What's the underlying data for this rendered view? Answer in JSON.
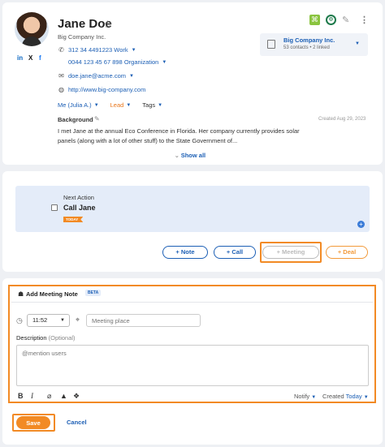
{
  "contact": {
    "name": "Jane Doe",
    "company": "Big Company Inc.",
    "social": [
      "in",
      "X",
      "f"
    ],
    "phone_work": "312 34 4491223 Work",
    "phone_org": "0044 123 45 67 898 Organization",
    "email": "doe.jane@acme.com",
    "website": "http://www.big-company.com",
    "owner": "Me (Julia A.)",
    "lead_status": "Lead",
    "tags": "Tags",
    "background_title": "Background",
    "background_created": "Created Aug 29, 2023",
    "background_text": "I met Jane at the annual Eco Conference in Florida. Her company currently provides solar panels (along with a lot of other stuff) to the State Government of...",
    "show_all": "Show all"
  },
  "company_box": {
    "name": "Big Company Inc.",
    "sub": "53 contacts • 2 linked"
  },
  "next_action": {
    "label": "Next Action",
    "title": "Call Jane",
    "badge": "TODAY"
  },
  "actions": {
    "note": "+ Note",
    "call": "+ Call",
    "meeting": "+ Meeting",
    "deal": "+ Deal"
  },
  "meeting_note": {
    "title": "Add Meeting Note",
    "beta": "BETA",
    "time": "11:52",
    "place_placeholder": "Meeting place",
    "description_label": "Description",
    "description_optional": "(Optional)",
    "description_placeholder": "@mention users",
    "notify": "Notify",
    "created_label": "Created",
    "created_value": "Today",
    "save": "Save",
    "cancel": "Cancel"
  },
  "colors": {
    "accent": "#1c5fb5",
    "orange": "#f28a24",
    "highlight_bg": "#e4ecf9"
  }
}
